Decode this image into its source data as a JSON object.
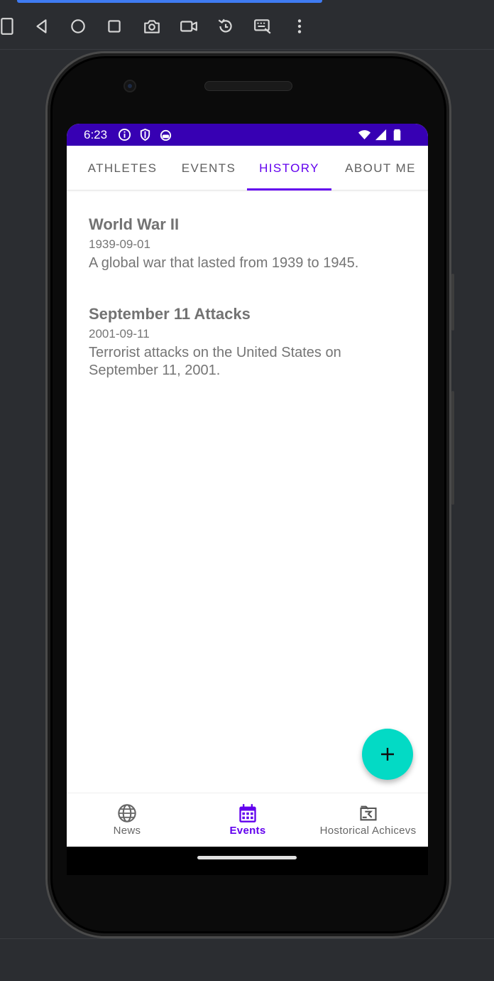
{
  "emulator_toolbar": {
    "buttons": [
      {
        "name": "rotate-device",
        "icon": "phone-rotate-icon"
      },
      {
        "name": "back",
        "icon": "back-triangle-icon"
      },
      {
        "name": "home",
        "icon": "home-circle-icon"
      },
      {
        "name": "overview",
        "icon": "overview-square-icon"
      },
      {
        "name": "screenshot",
        "icon": "camera-icon"
      },
      {
        "name": "screen-record",
        "icon": "video-camera-icon"
      },
      {
        "name": "snapshot-restore",
        "icon": "restore-icon"
      },
      {
        "name": "keyboard",
        "icon": "keyboard-icon"
      },
      {
        "name": "more",
        "icon": "more-vertical-icon"
      }
    ]
  },
  "status_bar": {
    "time": "6:23",
    "color": "#3700b3"
  },
  "top_tabs": {
    "items": [
      {
        "label": "ATHLETES"
      },
      {
        "label": "EVENTS"
      },
      {
        "label": "HISTORY"
      },
      {
        "label": "ABOUT ME"
      }
    ],
    "active_index": 2,
    "accent": "#6200ee"
  },
  "events": [
    {
      "title": "World War II",
      "date": "1939-09-01",
      "description": "A global war that lasted from 1939 to 1945."
    },
    {
      "title": "September 11 Attacks",
      "date": "2001-09-11",
      "description": "Terrorist attacks on the United States on September 11, 2001."
    }
  ],
  "fab": {
    "icon": "plus-icon",
    "color": "#03dac5"
  },
  "bottom_nav": {
    "items": [
      {
        "label": "News",
        "icon": "globe-icon"
      },
      {
        "label": "Events",
        "icon": "calendar-icon"
      },
      {
        "label": "Hostorical Achicevs",
        "icon": "historical-icon"
      }
    ],
    "active_index": 1
  }
}
